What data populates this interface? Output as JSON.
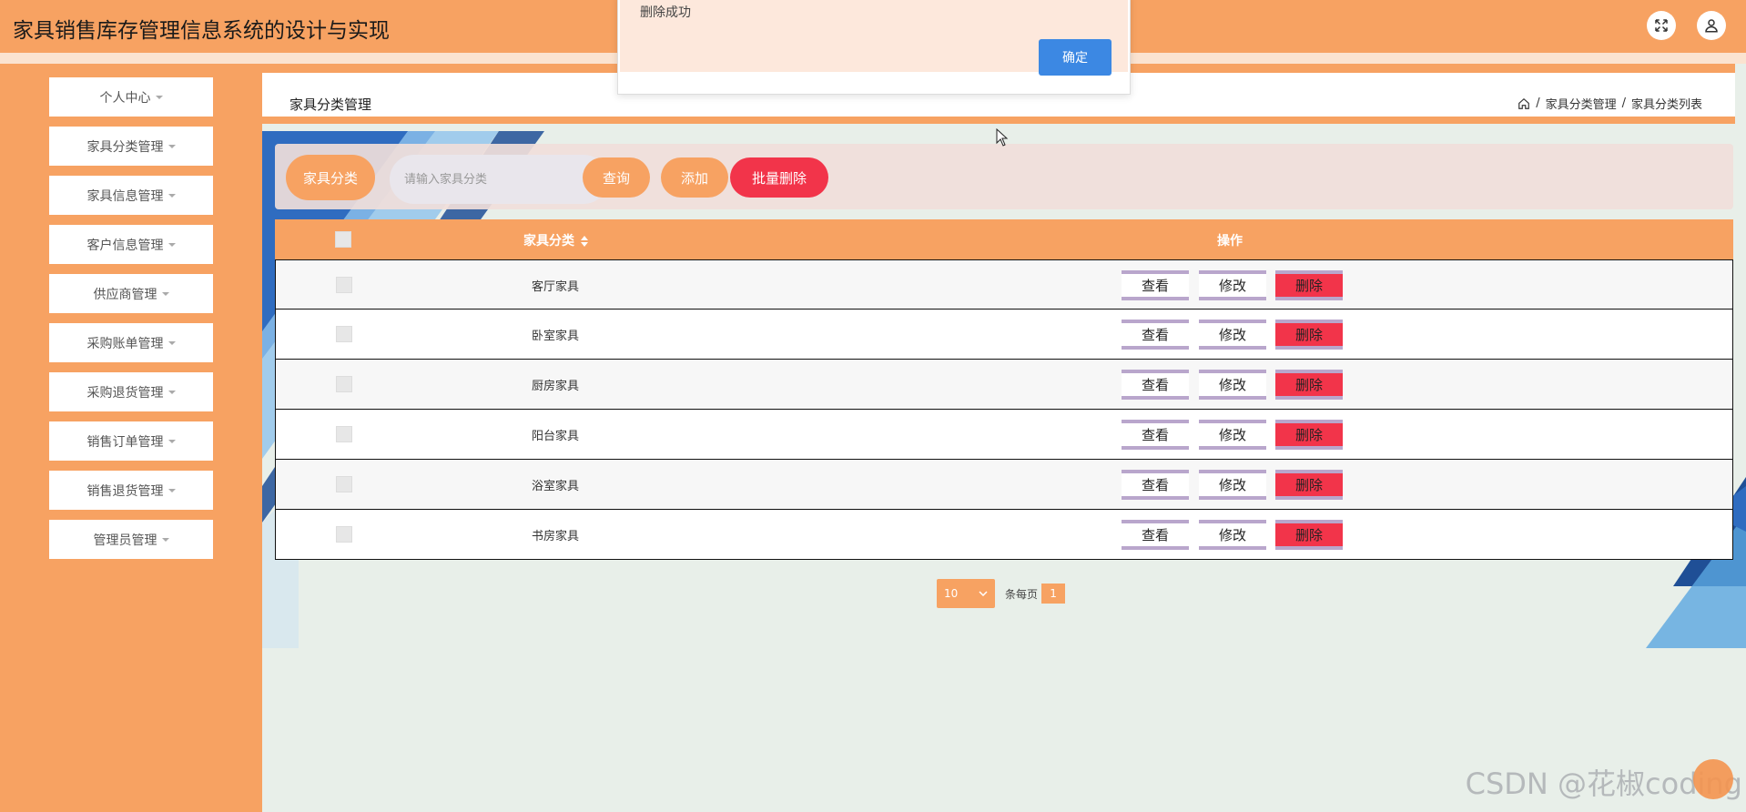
{
  "header": {
    "title": "家具销售库存管理信息系统的设计与实现",
    "fullscreen_icon": "expand-icon",
    "user_icon": "user-icon"
  },
  "sidebar": {
    "items": [
      {
        "label": "个人中心"
      },
      {
        "label": "家具分类管理"
      },
      {
        "label": "家具信息管理"
      },
      {
        "label": "客户信息管理"
      },
      {
        "label": "供应商管理"
      },
      {
        "label": "采购账单管理"
      },
      {
        "label": "采购退货管理"
      },
      {
        "label": "销售订单管理"
      },
      {
        "label": "销售退货管理"
      },
      {
        "label": "管理员管理"
      }
    ]
  },
  "page": {
    "title": "家具分类管理",
    "breadcrumb": [
      "家具分类管理",
      "家具分类列表"
    ],
    "breadcrumb_sep": "/"
  },
  "search": {
    "label": "家具分类",
    "placeholder": "请输入家具分类",
    "query_label": "查询",
    "add_label": "添加",
    "batch_delete_label": "批量删除"
  },
  "table": {
    "headers": {
      "category": "家具分类",
      "operations": "操作"
    },
    "rows": [
      {
        "category": "客厅家具"
      },
      {
        "category": "卧室家具"
      },
      {
        "category": "厨房家具"
      },
      {
        "category": "阳台家具"
      },
      {
        "category": "浴室家具"
      },
      {
        "category": "书房家具"
      }
    ],
    "actions": {
      "view": "查看",
      "edit": "修改",
      "delete": "删除"
    }
  },
  "pagination": {
    "page_size": "10",
    "per_page_text": "条每页",
    "current_page": "1"
  },
  "message_box": {
    "text": "删除成功",
    "confirm_label": "确定"
  },
  "watermark": "CSDN @花椒coding",
  "colors": {
    "accent": "#f7a262",
    "danger": "#f2344a",
    "primary": "#3c88e3",
    "content_bg": "#e8efe9"
  }
}
